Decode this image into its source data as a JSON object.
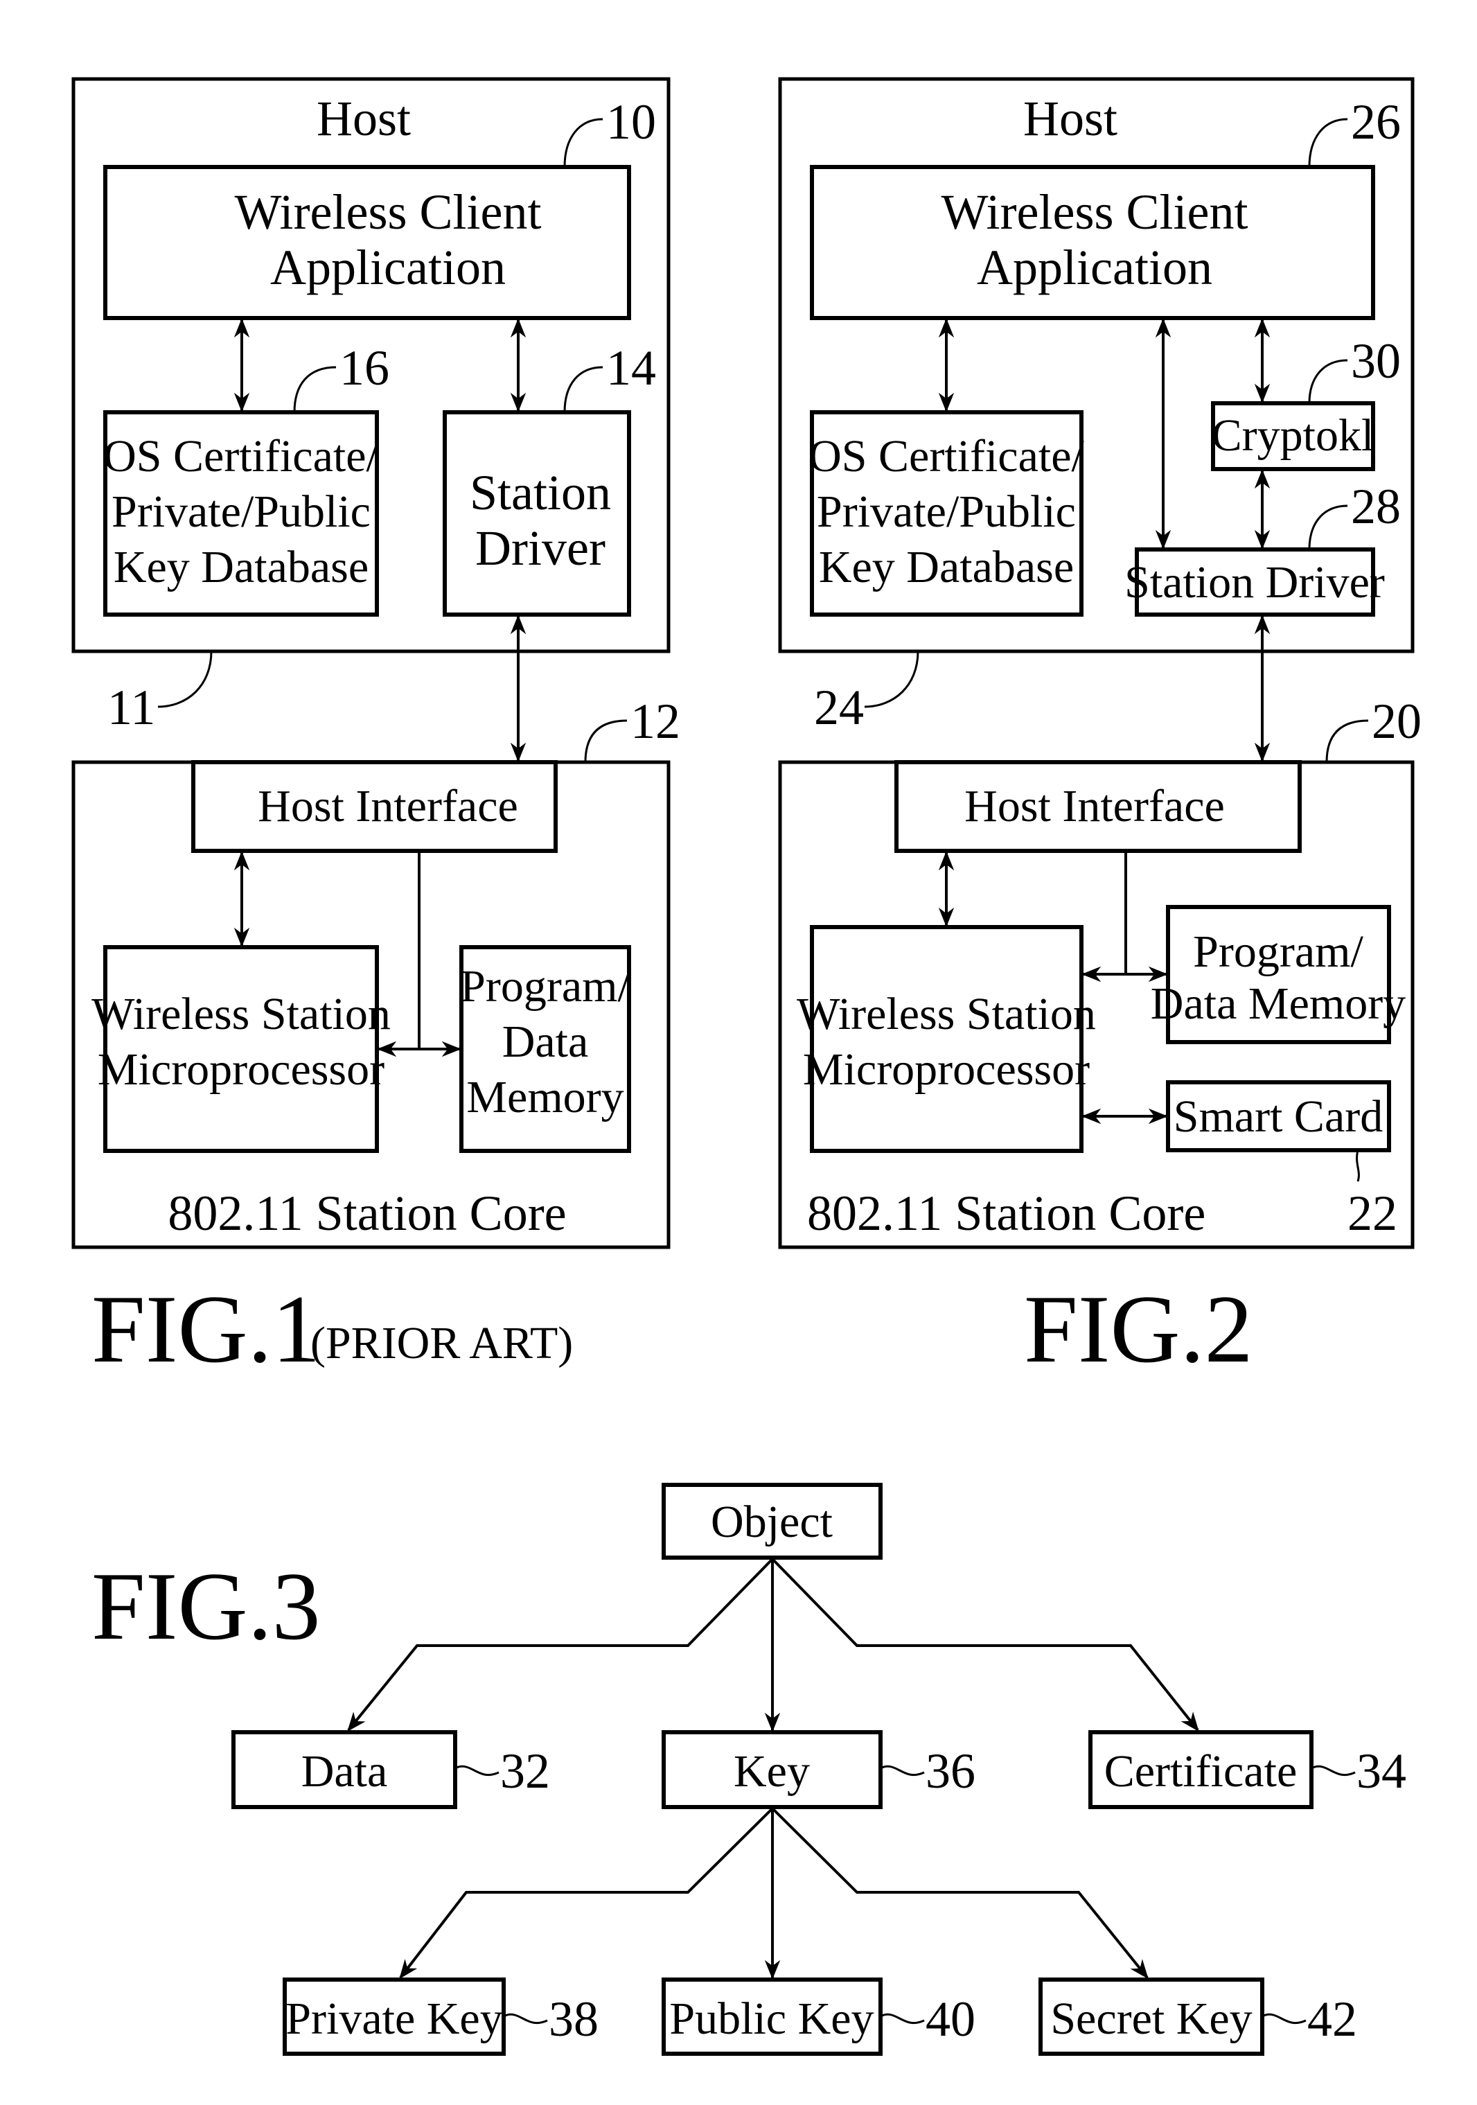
{
  "fig1": {
    "caption": "FIG.1",
    "caption_note": "(PRIOR ART)",
    "host": {
      "title": "Host",
      "ref": "11"
    },
    "wireless_client_app": {
      "lines": [
        "Wireless Client",
        "Application"
      ],
      "ref": "10"
    },
    "os_cert_db": {
      "lines": [
        "OS Certificate/",
        "Private/Public",
        "Key Database"
      ],
      "ref": "16"
    },
    "station_driver": {
      "lines": [
        "Station",
        "Driver"
      ],
      "ref": "14"
    },
    "station_core": {
      "title": "802.11 Station Core",
      "ref": "12"
    },
    "host_interface": {
      "label": "Host Interface"
    },
    "microprocessor": {
      "lines": [
        "Wireless Station",
        "Microprocessor"
      ]
    },
    "memory": {
      "lines": [
        "Program/",
        "Data",
        "Memory"
      ]
    }
  },
  "fig2": {
    "caption": "FIG.2",
    "host": {
      "title": "Host",
      "ref": "24"
    },
    "wireless_client_app": {
      "lines": [
        "Wireless Client",
        "Application"
      ],
      "ref": "26"
    },
    "os_cert_db": {
      "lines": [
        "OS Certificate/",
        "Private/Public",
        "Key Database"
      ]
    },
    "cryptoki": {
      "label": "Cryptokl",
      "ref": "30"
    },
    "station_driver": {
      "label": "Station Driver",
      "ref": "28"
    },
    "station_core": {
      "title": "802.11 Station Core",
      "ref": "20"
    },
    "host_interface": {
      "label": "Host Interface"
    },
    "microprocessor": {
      "lines": [
        "Wireless Station",
        "Microprocessor"
      ]
    },
    "memory": {
      "lines": [
        "Program/",
        "Data Memory"
      ]
    },
    "smart_card": {
      "label": "Smart Card",
      "ref": "22"
    }
  },
  "fig3": {
    "caption": "FIG.3",
    "object": {
      "label": "Object"
    },
    "data": {
      "label": "Data",
      "ref": "32"
    },
    "key": {
      "label": "Key",
      "ref": "36"
    },
    "certificate": {
      "label": "Certificate",
      "ref": "34"
    },
    "private_key": {
      "label": "Private Key",
      "ref": "38"
    },
    "public_key": {
      "label": "Public Key",
      "ref": "40"
    },
    "secret_key": {
      "label": "Secret Key",
      "ref": "42"
    }
  }
}
